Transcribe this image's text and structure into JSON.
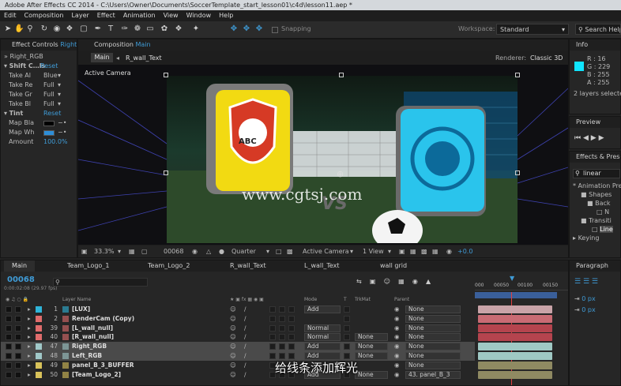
{
  "window": {
    "title": "Adobe After Effects CC 2014 - C:\\Users\\Owner\\Documents\\SoccerTemplate_start_lesson01\\c4d\\lesson11.aep *"
  },
  "menu": [
    "Edit",
    "Composition",
    "Layer",
    "Effect",
    "Animation",
    "View",
    "Window",
    "Help"
  ],
  "toolbar": {
    "snapping": "Snapping",
    "workspace_label": "Workspace:",
    "workspace_value": "Standard",
    "search_help": "Search Help"
  },
  "effect_controls": {
    "tab": "Effect Controls",
    "tab_target": "Right",
    "layer": "» Right_RGB",
    "shift_channels": "Shift C…ls",
    "reset": "Reset",
    "props": [
      {
        "label": "Take Al",
        "value": "Blue"
      },
      {
        "label": "Take Re",
        "value": "Full"
      },
      {
        "label": "Take Gr",
        "value": "Full"
      },
      {
        "label": "Take Bl",
        "value": "Full"
      }
    ],
    "tint": "Tint",
    "tint_reset": "Reset",
    "map_black": "Map Bla",
    "map_white": "Map Wh",
    "amount_label": "Amount",
    "amount_value": "100.0%"
  },
  "composition": {
    "tab": "Composition",
    "tab_name": "Main",
    "crumb_main": "Main",
    "crumb_layer": "R_wall_Text",
    "renderer_label": "Renderer:",
    "renderer_value": "Classic 3D",
    "active_camera": "Active Camera",
    "zoom": "33.3%",
    "timecode": "00068",
    "resolution": "Quarter",
    "view": "Active Camera",
    "views": "1 View",
    "exposure": "+0.0",
    "watermark": "www.cgtsj.com",
    "logo_left": "ABC",
    "vs": "VS"
  },
  "info": {
    "tab": "Info",
    "r": "R : 16",
    "g": "G : 229",
    "b": "B : 255",
    "a": "A : 255",
    "selected": "2 layers selected",
    "swatch": "#10e5ff"
  },
  "preview": {
    "tab": "Preview"
  },
  "effects_presets": {
    "tab": "Effects & Presets",
    "search": "linear",
    "tree": [
      "* Animation Pre",
      "Shapes",
      "Back",
      "N",
      "Transiti",
      "Line"
    ],
    "keying": "Keying"
  },
  "paragraph": {
    "tab": "Paragraph",
    "indent1": "0 px",
    "indent2": "0 px"
  },
  "timeline": {
    "tabs": [
      "Main",
      "Team_Logo_1",
      "Team_Logo_2",
      "R_wall_Text",
      "L_wall_Text",
      "wall grid"
    ],
    "timecode": "00068",
    "timecode_sub": "0:00:02:08 (29.97 fps)",
    "headers": {
      "layer_name": "Layer Name",
      "mode": "Mode",
      "t": "T",
      "trkmat": "TrkMat",
      "parent": "Parent"
    },
    "ruler": [
      "000",
      "00050",
      "00100",
      "00150"
    ],
    "rows": [
      {
        "num": "1",
        "name": "[LUX]",
        "color": "#2fb4d8",
        "mode": "Add",
        "trkmat": "",
        "parent": "None",
        "bar": "#c9a3a8"
      },
      {
        "num": "2",
        "name": "RenderCam (Copy)",
        "color": "#e06c6c",
        "mode": "",
        "trkmat": "",
        "parent": "None",
        "bar": "#c96b74"
      },
      {
        "num": "39",
        "name": "[L_wall_null]",
        "color": "#e06c6c",
        "mode": "Normal",
        "trkmat": "",
        "parent": "None",
        "bar": "#b5444e"
      },
      {
        "num": "40",
        "name": "[R_wall_null]",
        "color": "#e06c6c",
        "mode": "Normal",
        "trkmat": "None",
        "parent": "None",
        "bar": "#b5444e"
      },
      {
        "num": "47",
        "name": "Right_RGB",
        "color": "#a0c8c8",
        "mode": "Add",
        "trkmat": "None",
        "parent": "None",
        "bar": "#9fc9c4"
      },
      {
        "num": "48",
        "name": "Left_RGB",
        "color": "#a0c8c8",
        "mode": "Add",
        "trkmat": "None",
        "parent": "None",
        "bar": "#9fc9c4"
      },
      {
        "num": "49",
        "name": "panel_B_3_BUFFER",
        "color": "#d8c25a",
        "mode": "",
        "trkmat": "",
        "parent": "None",
        "bar": "#8f8a62"
      },
      {
        "num": "50",
        "name": "[Team_Logo_2]",
        "color": "#d8c25a",
        "mode": "Add",
        "trkmat": "None",
        "parent": "43. panel_B_3",
        "bar": "#8f8a62"
      }
    ]
  },
  "subtitle": "给线条添加辉光"
}
